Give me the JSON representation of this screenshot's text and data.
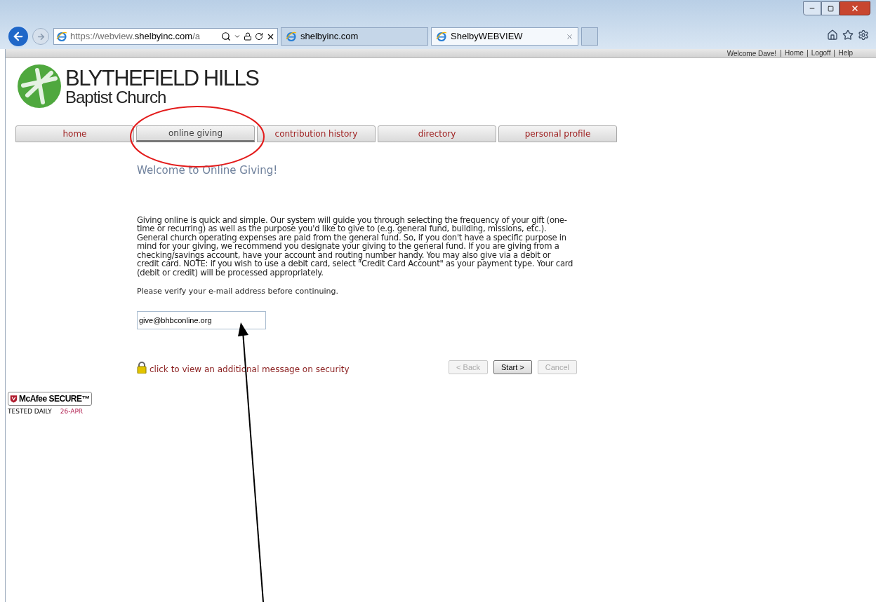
{
  "browser": {
    "address": {
      "prefix": "https://webview.",
      "domain": "shelbyinc.com",
      "suffix": "/a"
    },
    "tabs": [
      {
        "title": "shelbyinc.com",
        "selected": false
      },
      {
        "title": "ShelbyWEBVIEW",
        "selected": true
      }
    ]
  },
  "topbar": {
    "welcome": "Welcome Dave!",
    "links": [
      "Home",
      "Logoff",
      "Help"
    ]
  },
  "logo": {
    "line1": "BLYTHEFIELD HILLS",
    "line2": "Baptist Church"
  },
  "nav": [
    {
      "label": "home",
      "selected": false
    },
    {
      "label": "online giving",
      "selected": true
    },
    {
      "label": "contribution history",
      "selected": false
    },
    {
      "label": "directory",
      "selected": false
    },
    {
      "label": "personal profile",
      "selected": false
    }
  ],
  "heading": "Welcome to Online Giving!",
  "intro": "Giving online is quick and simple. Our system will guide you through selecting the frequency of your gift (one-time or recurring) as well as the purpose you'd like to give to (e.g. general fund, building, missions, etc.). General church operating expenses are paid from the general fund. So, if you don't have a specific purpose in mind for your giving, we recommend you designate your giving to the general fund. If you are giving from a checking/savings account, have your account and routing number handy. You may also give via a debit or credit card. NOTE: if you wish to use a debit card, select \"Credit Card Account\" as your payment type. Your card (debit or credit) will be processed appropriately.",
  "prompt": "Please verify your e-mail address before continuing.",
  "email": {
    "value": "give@bhbconline.org"
  },
  "security_link": "click to view an additional message on security",
  "buttons": [
    {
      "label": "< Back",
      "disabled": true
    },
    {
      "label": "Start >",
      "disabled": false
    },
    {
      "label": "Cancel",
      "disabled": true
    }
  ],
  "badge": {
    "brand": "McAfee SECURE™",
    "tested": "TESTED DAILY",
    "date": "26-APR"
  },
  "annotations": {
    "ellipse": true,
    "arrow": true
  }
}
